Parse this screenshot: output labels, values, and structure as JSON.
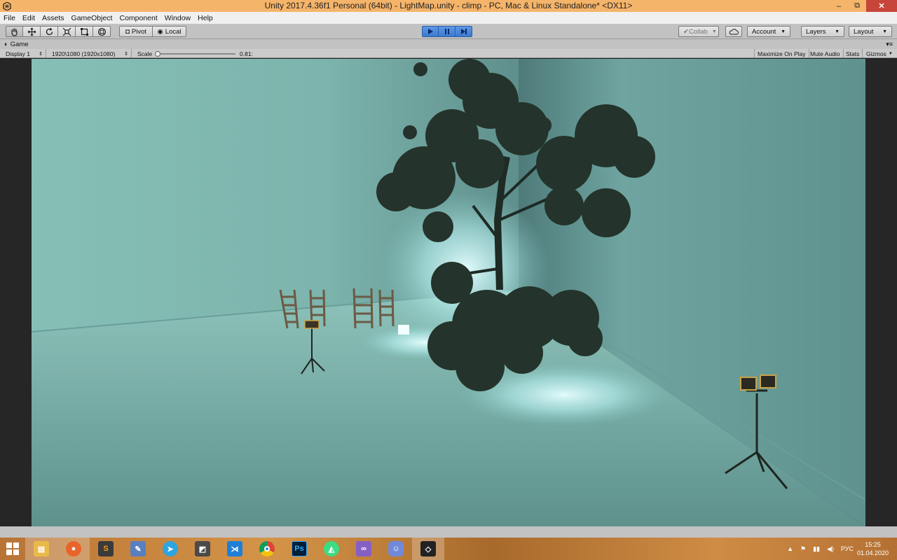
{
  "window": {
    "title": "Unity 2017.4.36f1 Personal (64bit) - LightMap.unity - climp - PC, Mac & Linux Standalone* <DX11>",
    "minimize": "–",
    "maximize": "⧉",
    "close": "✕"
  },
  "menu": [
    "File",
    "Edit",
    "Assets",
    "GameObject",
    "Component",
    "Window",
    "Help"
  ],
  "toolbar": {
    "pivot_label": "Pivot",
    "local_label": "Local",
    "collab_label": "Collab",
    "account_label": "Account",
    "layers_label": "Layers",
    "layout_label": "Layout"
  },
  "game_view": {
    "tab_label": "Game",
    "display": "Display 1",
    "resolution": "1920\\1080 (1920x1080)",
    "scale_label": "Scale",
    "scale_value": "0.81:",
    "maximize_on_play": "Maximize On Play",
    "mute_audio": "Mute Audio",
    "stats": "Stats",
    "gizmos": "Gizmos"
  },
  "taskbar": {
    "apps": [
      "file-explorer",
      "firefox",
      "sublime-text",
      "paint",
      "telegram",
      "screenshot-tool",
      "vscode",
      "chrome",
      "photoshop",
      "android-studio",
      "visual-studio",
      "discord",
      "unity"
    ],
    "language": "РУС",
    "time": "15:25",
    "date": "01.04.2020"
  },
  "colors": {
    "titlebar": "#f4b46a",
    "play_active": "#3d7ad0",
    "scene_floor": "#6aa39c",
    "scene_wall": "#7fb7af"
  }
}
